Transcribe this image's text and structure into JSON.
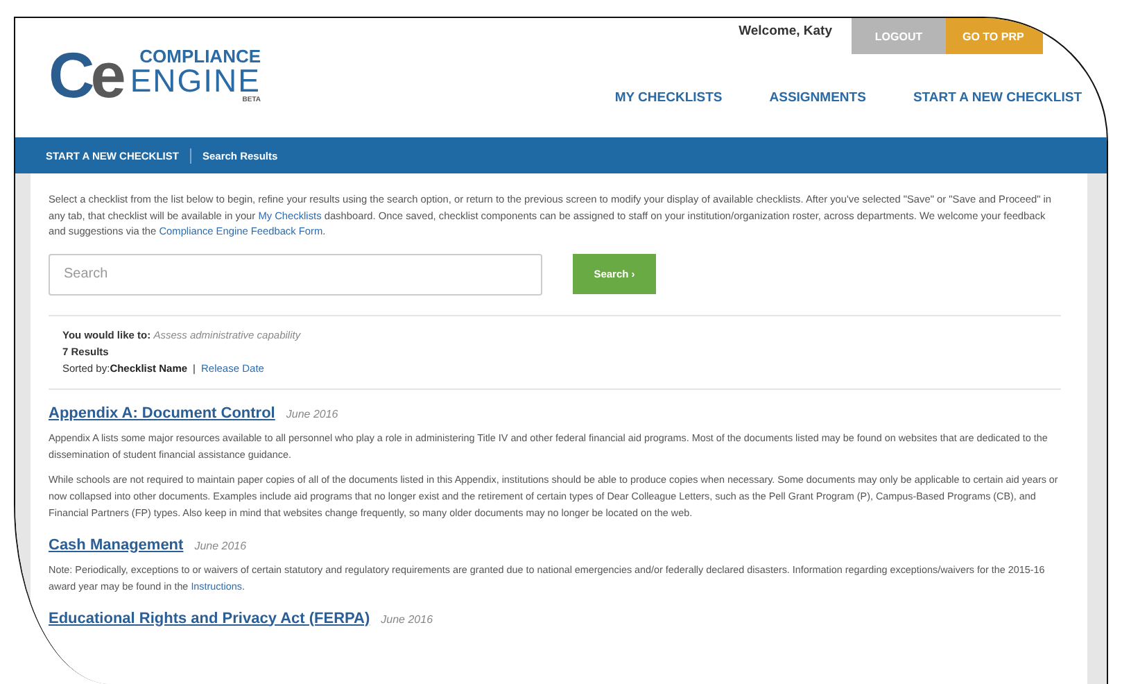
{
  "header": {
    "logo": {
      "mark": [
        "C",
        "e"
      ],
      "line1": "COMPLIANCE",
      "line2": "ENGINE",
      "tag": "BETA"
    },
    "welcome": "Welcome, Katy",
    "buttons": [
      {
        "label": "LOGOUT",
        "kind": "logout"
      },
      {
        "label": "GO TO PRP",
        "kind": "go"
      }
    ],
    "nav": [
      "MY CHECKLISTS",
      "ASSIGNMENTS",
      "START A NEW CHECKLIST"
    ]
  },
  "breadcrumb": [
    "START A NEW CHECKLIST",
    "Search Results"
  ],
  "intro": [
    {
      "text": "Select a checklist from the list below to begin, refine your results using the search option, or return to the previous screen to modify your display of available checklists. After you've selected \"Save\" or \"Save and Proceed\" in any tab, that checklist will be available in your ",
      "kind": "text"
    },
    {
      "text": "My Checklists",
      "kind": "link"
    },
    {
      "text": " dashboard. Once saved, checklist components can be assigned to staff on your institution/organization roster, across departments. We welcome your feedback and suggestions via the ",
      "kind": "text"
    },
    {
      "text": "Compliance Engine Feedback Form",
      "kind": "link"
    },
    {
      "text": ".",
      "kind": "text"
    }
  ],
  "search": {
    "placeholder": "Search",
    "button": "Search ›"
  },
  "summary": {
    "goal_label": "You would like to:",
    "goal": "Assess administrative capability",
    "count": "7 Results",
    "sort_label": "Sorted by:",
    "sort_options": [
      {
        "label": "Checklist Name",
        "selected": true
      },
      {
        "label": "Release Date",
        "selected": false
      }
    ],
    "separator": "|"
  },
  "results": [
    {
      "title": "Appendix A: Document Control",
      "date": "June 2016",
      "paragraphs": [
        [
          {
            "text": "Appendix A lists some major resources available to all personnel who play a role in administering Title IV and other federal financial aid programs. Most of the documents listed may be found on websites that are dedicated to the dissemination of student financial assistance guidance.",
            "kind": "text"
          }
        ],
        [
          {
            "text": "While schools are not required to maintain paper copies of all of the documents listed in this Appendix, institutions should be able to produce copies when necessary. Some documents may only be applicable to certain aid years or now collapsed into other documents. Examples include aid programs that no longer exist and the retirement of certain types of Dear Colleague Letters, such as the Pell Grant Program (P), Campus-Based Programs (CB), and Financial Partners (FP) types. Also keep in mind that websites change frequently, so many older documents may no longer be located on the web.",
            "kind": "text"
          }
        ]
      ]
    },
    {
      "title": "Cash Management",
      "date": "June 2016",
      "paragraphs": [
        [
          {
            "text": "Note: Periodically, exceptions to or waivers of certain statutory and regulatory requirements are granted due to national emergencies and/or federally declared disasters. Information regarding exceptions/waivers for the 2015-16 award year may be found in the ",
            "kind": "text"
          },
          {
            "text": "Instructions",
            "kind": "link"
          },
          {
            "text": ".",
            "kind": "text"
          }
        ]
      ]
    },
    {
      "title": "Educational Rights and Privacy Act (FERPA)",
      "date": "June 2016"
    }
  ]
}
